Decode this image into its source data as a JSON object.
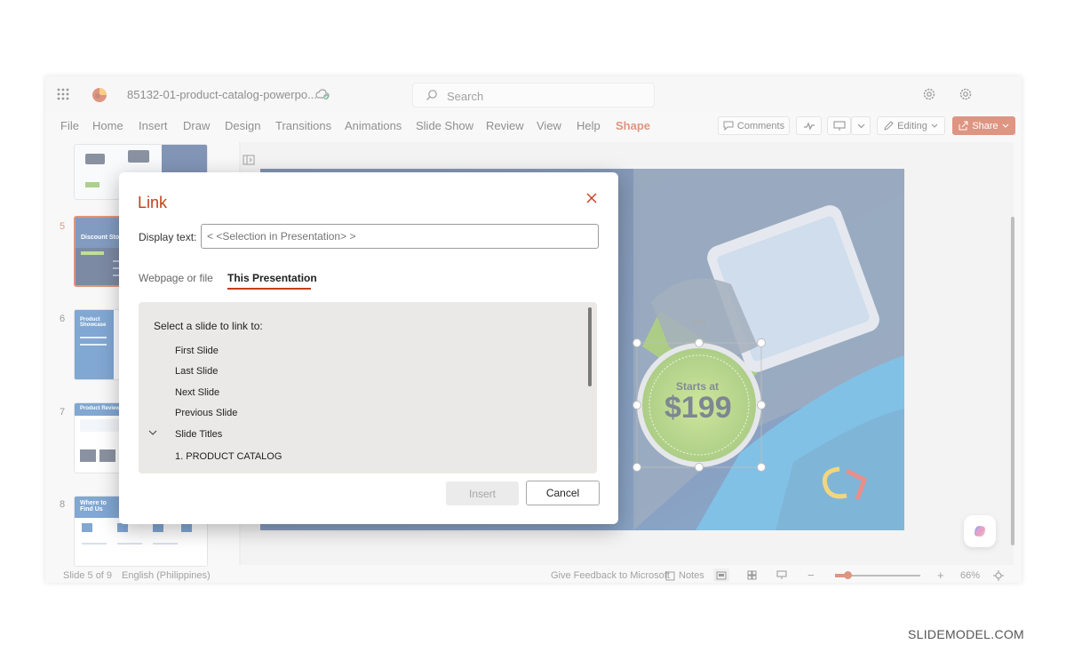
{
  "titlebar": {
    "doc_name": "85132-01-product-catalog-powerpo...",
    "search_label": "Search"
  },
  "menu": {
    "items": [
      "File",
      "Home",
      "Insert",
      "Draw",
      "Design",
      "Transitions",
      "Animations",
      "Slide Show",
      "Review",
      "View",
      "Help",
      "Shape"
    ],
    "active": "Shape",
    "comments_label": "Comments",
    "editing_label": "Editing",
    "share_label": "Share"
  },
  "thumbnails": {
    "numbers": [
      "5",
      "6",
      "7",
      "8"
    ],
    "slide5_title": "Discount Store",
    "slide6_title": "Product Showcase",
    "slide7_title": "Product Review",
    "slide8_title": "Where to Find Us"
  },
  "slide": {
    "badge_top": "Starts at",
    "badge_price": "$199"
  },
  "dialog": {
    "title": "Link",
    "display_label": "Display text:",
    "display_value": "< <Selection in Presentation> >",
    "tabs": [
      "Webpage or file",
      "This Presentation"
    ],
    "active_tab": "This Presentation",
    "list_header": "Select a slide to link to:",
    "items": [
      "First Slide",
      "Last Slide",
      "Next Slide",
      "Previous Slide",
      "Slide Titles",
      "1. PRODUCT CATALOG"
    ],
    "insert_label": "Insert",
    "cancel_label": "Cancel"
  },
  "statusbar": {
    "slide_info": "Slide 5 of 9",
    "language": "English (Philippines)",
    "feedback": "Give Feedback to Microsoft",
    "notes": "Notes",
    "zoom": "66%"
  },
  "colors": {
    "accent": "#c43e1c",
    "slide_blue": "#1a5fa8",
    "badge_green": "#8dc63f"
  },
  "watermark": "SLIDEMODEL.COM"
}
